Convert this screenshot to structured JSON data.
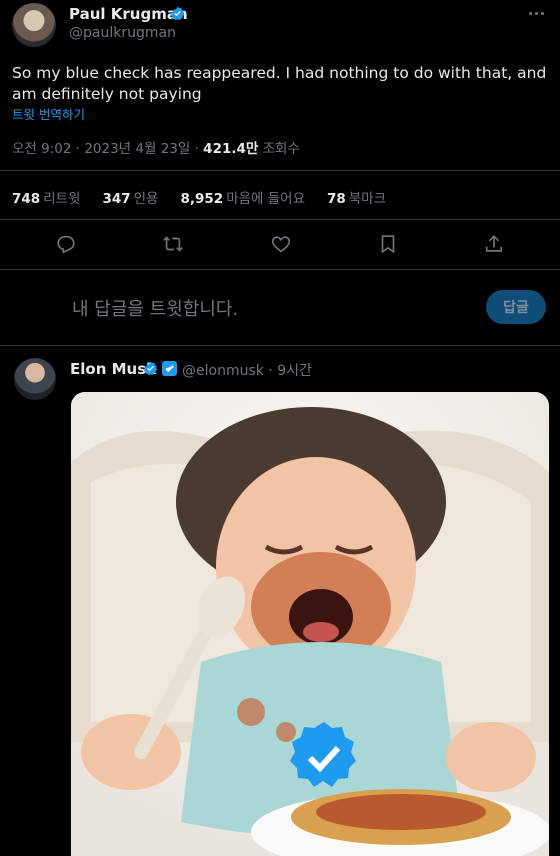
{
  "tweet": {
    "author_name": "Paul Krugman",
    "author_handle": "@paulkrugman",
    "text": "So my blue check has reappeared. I had nothing to do with that, and am definitely not paying",
    "translate_link": "트윗 번역하기",
    "time": "오전 9:02",
    "sep1": " · ",
    "date": "2023년 4월 23일",
    "sep2": " · ",
    "views_count": "421.4만",
    "views_label": " 조회수",
    "stats": {
      "retweets_count": "748",
      "retweets_label": "리트윗",
      "quotes_count": "347",
      "quotes_label": "인용",
      "likes_count": "8,952",
      "likes_label": "마음에 들어요",
      "bookmarks_count": "78",
      "bookmarks_label": "북마크"
    },
    "actions": [
      "reply-icon",
      "retweet-icon",
      "like-icon",
      "bookmark-icon",
      "share-icon"
    ]
  },
  "reply_box": {
    "placeholder": "내 답글을 트윗합니다.",
    "button_label": "답글"
  },
  "reply_tweet": {
    "author_name": "Elon Musk",
    "author_handle": "@elonmusk",
    "sep": " · ",
    "time": "9시간"
  },
  "colors": {
    "background": "#000000",
    "accent": "#1d9bf0",
    "muted_text": "#71767b",
    "divider": "#2f3336",
    "reply_button_bg": "#0f4e78"
  }
}
